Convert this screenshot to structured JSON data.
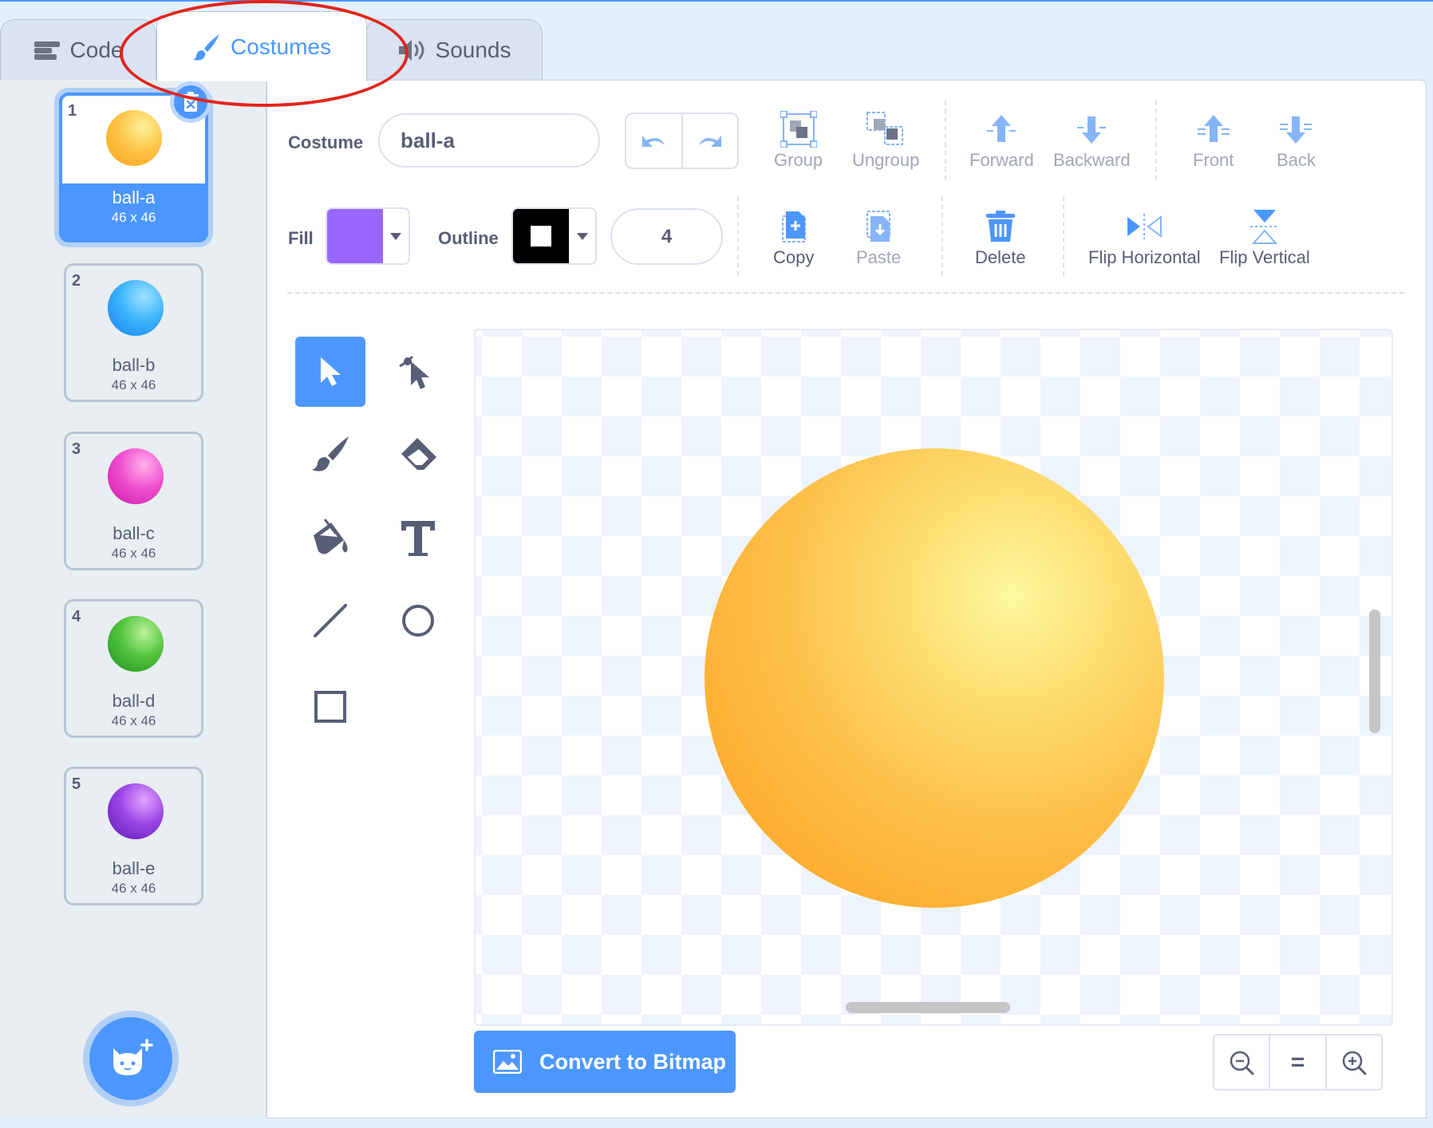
{
  "tabs": {
    "code": "Code",
    "costumes": "Costumes",
    "sounds": "Sounds"
  },
  "costumes": [
    {
      "num": "1",
      "name": "ball-a",
      "size": "46 x 46",
      "color": "#fdb530",
      "selected": true
    },
    {
      "num": "2",
      "name": "ball-b",
      "size": "46 x 46",
      "color": "#2fa6f5"
    },
    {
      "num": "3",
      "name": "ball-c",
      "size": "46 x 46",
      "color": "#e83fc6"
    },
    {
      "num": "4",
      "name": "ball-d",
      "size": "46 x 46",
      "color": "#45b437"
    },
    {
      "num": "5",
      "name": "ball-e",
      "size": "46 x 46",
      "color": "#8a3be0"
    }
  ],
  "toolbar": {
    "costume_label": "Costume",
    "costume_name": "ball-a",
    "group": "Group",
    "ungroup": "Ungroup",
    "forward": "Forward",
    "backward": "Backward",
    "front": "Front",
    "back": "Back",
    "fill_label": "Fill",
    "fill_color": "#9966ff",
    "outline_label": "Outline",
    "outline_color": "#000000",
    "outline_width": "4",
    "copy": "Copy",
    "paste": "Paste",
    "delete": "Delete",
    "flip_horizontal": "Flip Horizontal",
    "flip_vertical": "Flip Vertical"
  },
  "tools": [
    "select-tool",
    "reshape-tool",
    "brush-tool",
    "eraser-tool",
    "fill-tool",
    "text-tool",
    "line-tool",
    "circle-tool",
    "rectangle-tool"
  ],
  "convert_button": "Convert to Bitmap",
  "zoom": {
    "zoom_out": "zoom-out-icon",
    "reset": "=",
    "zoom_in": "zoom-in-icon"
  },
  "annotation": {
    "color": "#e2241b"
  }
}
